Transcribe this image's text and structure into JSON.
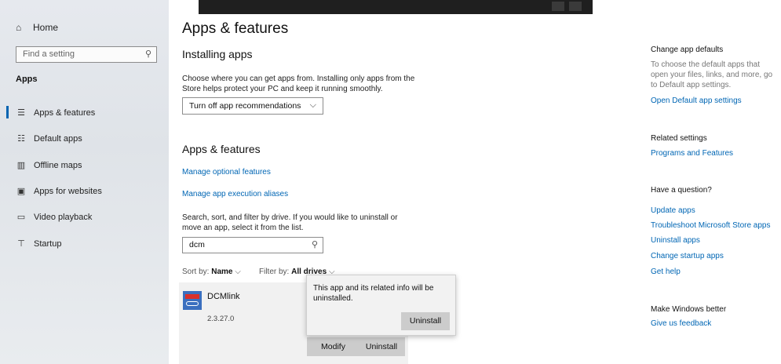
{
  "sidebar": {
    "home": {
      "label": "Home",
      "icon": "home-icon"
    },
    "search_placeholder": "Find a setting",
    "section_title": "Apps",
    "items": [
      {
        "label": "Apps & features",
        "icon": "list-icon",
        "active": true
      },
      {
        "label": "Default apps",
        "icon": "default-apps-icon"
      },
      {
        "label": "Offline maps",
        "icon": "map-icon"
      },
      {
        "label": "Apps for websites",
        "icon": "web-app-icon"
      },
      {
        "label": "Video playback",
        "icon": "video-icon"
      },
      {
        "label": "Startup",
        "icon": "startup-icon"
      }
    ]
  },
  "main": {
    "title": "Apps & features",
    "installing": {
      "heading": "Installing apps",
      "description": "Choose where you can get apps from. Installing only apps from the Store helps protect your PC and keep it running smoothly.",
      "dropdown_value": "Turn off app recommendations"
    },
    "apps_features": {
      "heading": "Apps & features",
      "link_optional": "Manage optional features",
      "link_aliases": "Manage app execution aliases",
      "search_description": "Search, sort, and filter by drive. If you would like to uninstall or move an app, select it from the list.",
      "search_value": "dcm",
      "sort_label": "Sort by:",
      "sort_value": "Name",
      "filter_label": "Filter by:",
      "filter_value": "All drives"
    },
    "app": {
      "name": "DCMlink",
      "version": "2.3.27.0",
      "modify_label": "Modify",
      "uninstall_label": "Uninstall"
    },
    "popup": {
      "message": "This app and its related info will be uninstalled.",
      "uninstall_label": "Uninstall"
    }
  },
  "right": {
    "defaults_heading": "Change app defaults",
    "defaults_text": "To choose the default apps that open your files, links, and more, go to Default app settings.",
    "defaults_link": "Open Default app settings",
    "related_heading": "Related settings",
    "related_link": "Programs and Features",
    "question_heading": "Have a question?",
    "question_links": [
      "Update apps",
      "Troubleshoot Microsoft Store apps",
      "Uninstall apps",
      "Change startup apps",
      "Get help"
    ],
    "better_heading": "Make Windows better",
    "better_link": "Give us feedback"
  },
  "colors": {
    "accent": "#0063b1",
    "link": "#0066b4",
    "button": "#cccccc"
  }
}
